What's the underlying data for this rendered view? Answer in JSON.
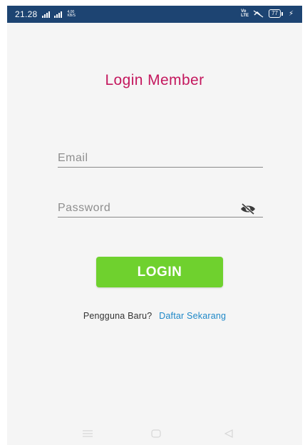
{
  "status_bar": {
    "time": "21.28",
    "net_speed_value": "4,00",
    "net_speed_unit": "KB/S",
    "volte_top": "Vo",
    "volte_bottom": "LTE",
    "battery": "77",
    "bg_color": "#1d4472"
  },
  "login": {
    "title": "Login Member",
    "title_color": "#c4185e",
    "email_placeholder": "Email",
    "password_placeholder": "Password",
    "password_toggle_icon": "eye-off-icon",
    "button_label": "LOGIN",
    "button_color": "#6fd12e"
  },
  "signup": {
    "question": "Pengguna Baru?",
    "link_label": "Daftar Sekarang",
    "link_color": "#1e88c8"
  },
  "nav_bar": {
    "items": [
      "menu-icon",
      "home-icon",
      "back-icon"
    ]
  }
}
